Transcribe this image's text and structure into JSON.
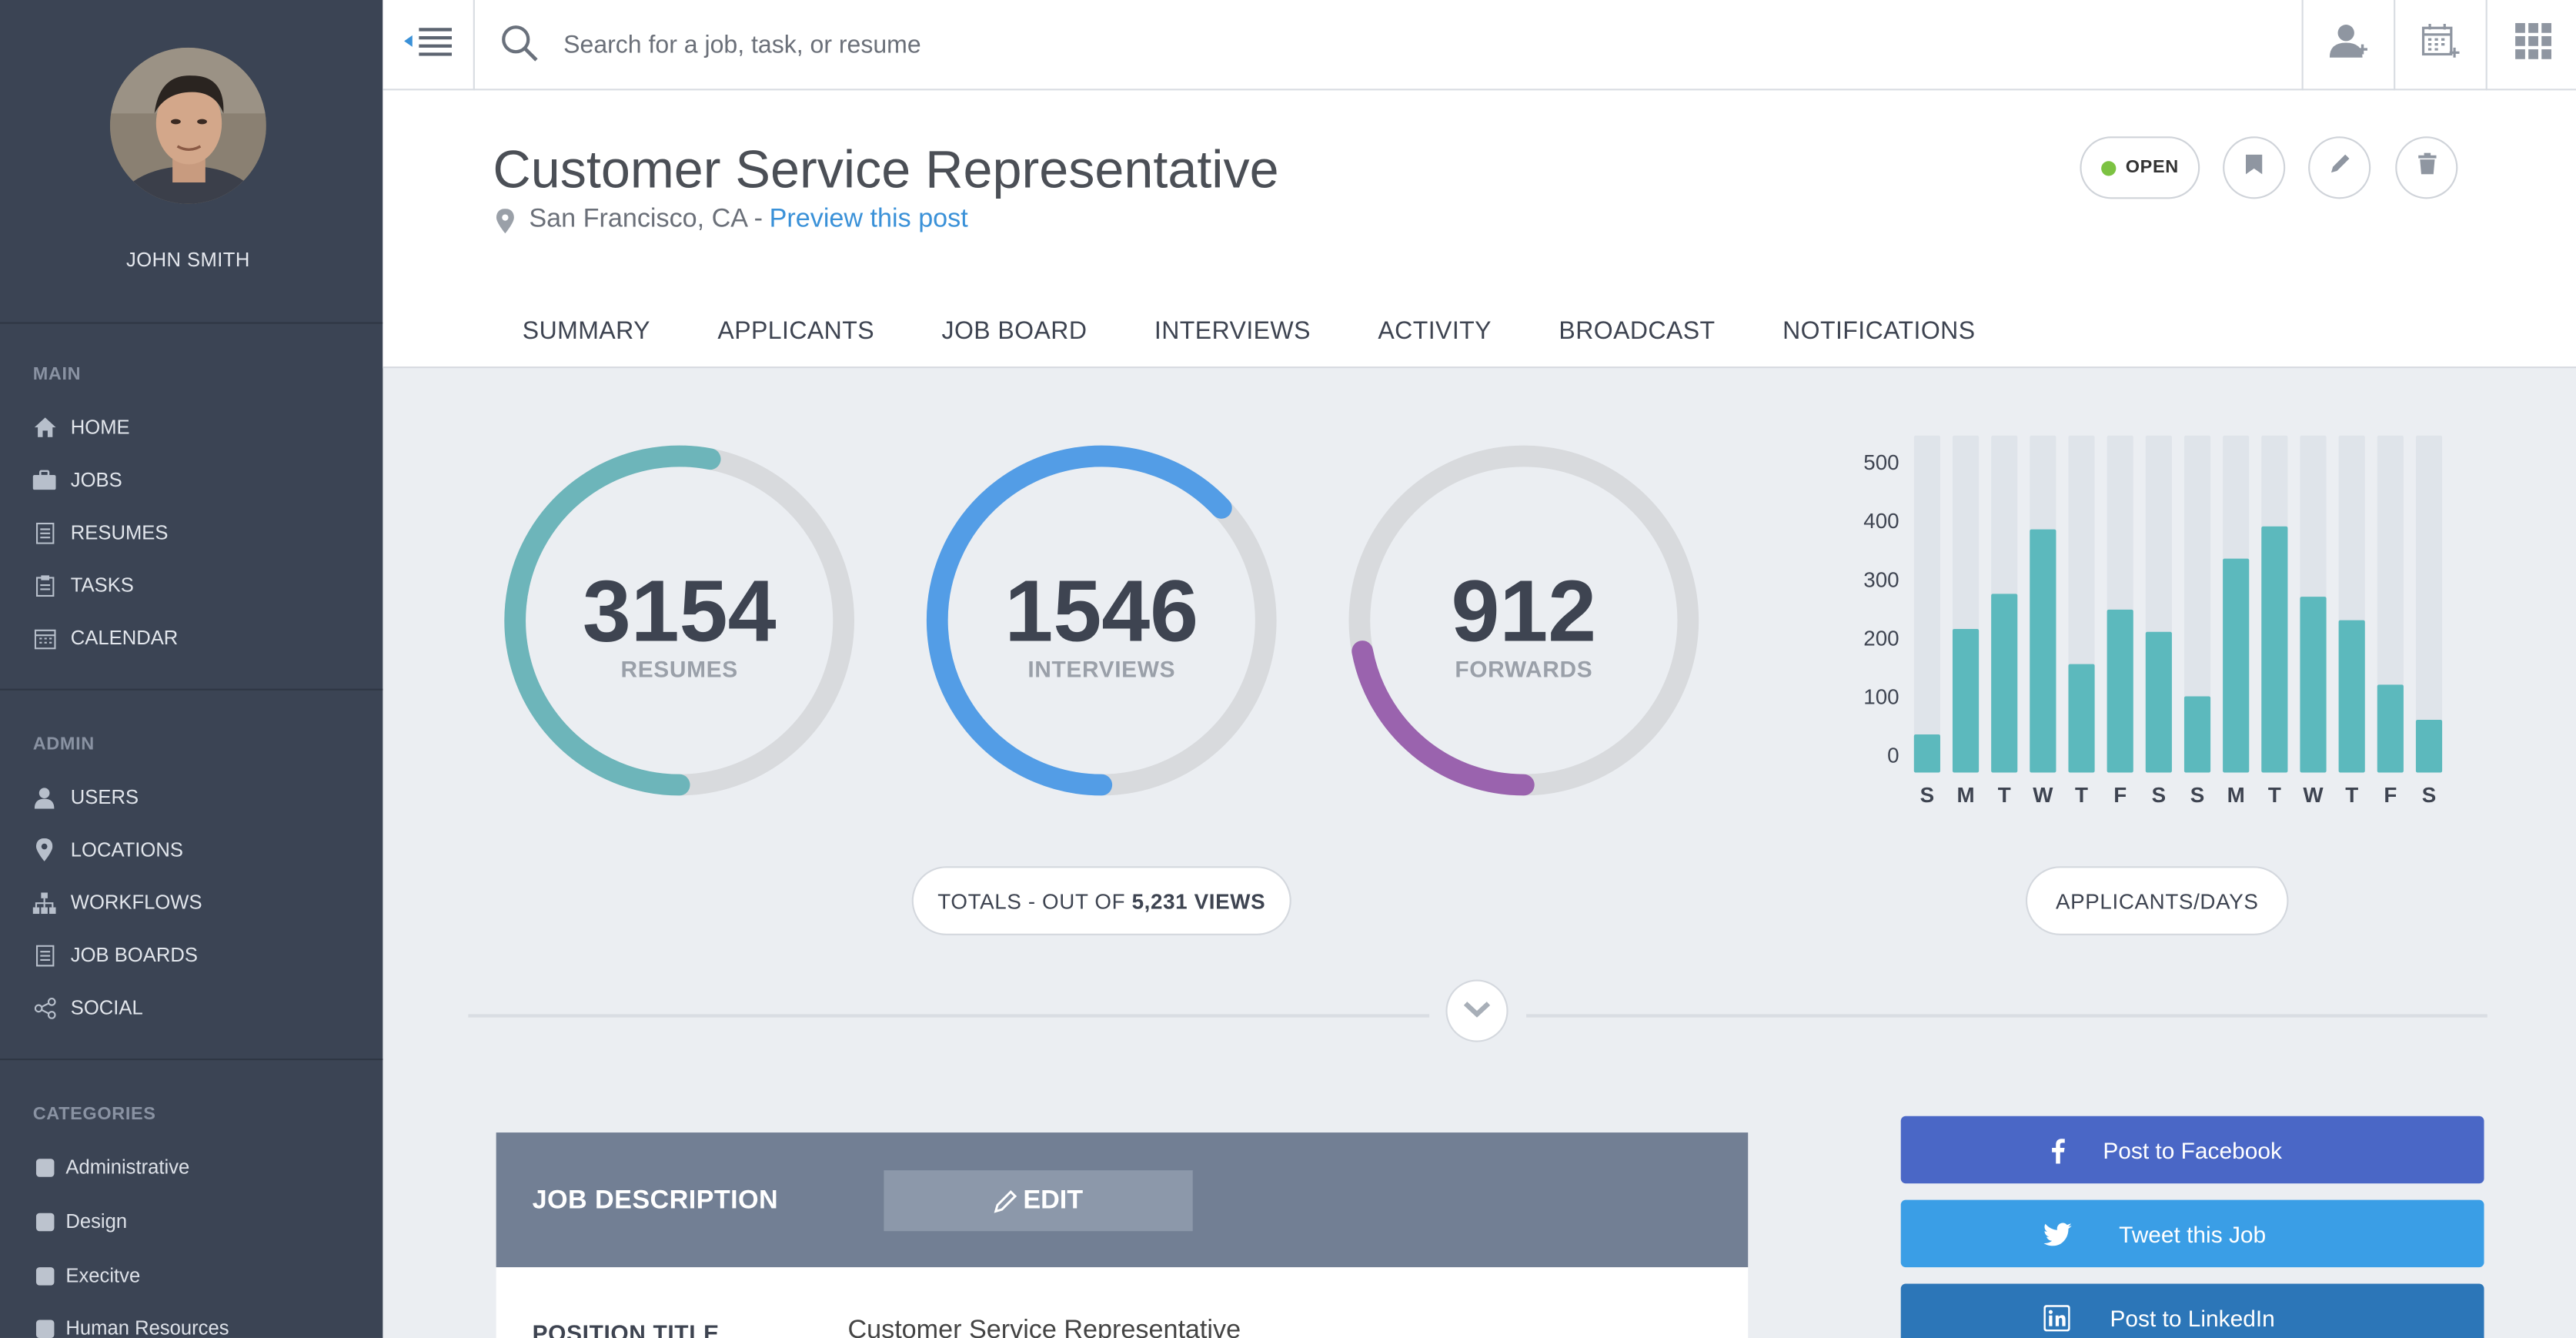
{
  "sidebar": {
    "user_name": "JOHN SMITH",
    "sections": {
      "main": "MAIN",
      "admin": "ADMIN",
      "categories": "CATEGORIES"
    },
    "main_items": [
      "HOME",
      "JOBS",
      "RESUMES",
      "TASKS",
      "CALENDAR"
    ],
    "admin_items": [
      "USERS",
      "LOCATIONS",
      "WORKFLOWS",
      "JOB BOARDS",
      "SOCIAL"
    ],
    "category_items": [
      "Administrative",
      "Design",
      "Execitve",
      "Human Resources"
    ]
  },
  "topbar": {
    "search_placeholder": "Search for a job, task, or resume"
  },
  "job": {
    "title": "Customer Service Representative",
    "location": "San Francisco, CA -",
    "preview_link": "Preview this post",
    "status": "OPEN"
  },
  "tabs": [
    "SUMMARY",
    "APPLICANTS",
    "JOB BOARD",
    "INTERVIEWS",
    "ACTIVITY",
    "BROADCAST",
    "NOTIFICATIONS"
  ],
  "stats": {
    "resumes": {
      "value": "3154",
      "label": "RESUMES",
      "fraction": 0.53,
      "color": "#6db5ba"
    },
    "interviews": {
      "value": "1546",
      "label": "INTERVIEWS",
      "fraction": 0.63,
      "color": "#539de6"
    },
    "forwards": {
      "value": "912",
      "label": "FORWARDS",
      "fraction": 0.22,
      "color": "#9a63ae"
    },
    "totals_prefix": "TOTALS - OUT OF",
    "totals_value": "5,231 VIEWS"
  },
  "chart_data": {
    "type": "bar",
    "categories": [
      "S",
      "M",
      "T",
      "W",
      "T",
      "F",
      "S",
      "S",
      "M",
      "T",
      "W",
      "T",
      "F",
      "S"
    ],
    "values": [
      65,
      245,
      305,
      415,
      185,
      278,
      240,
      130,
      365,
      420,
      300,
      260,
      150,
      90
    ],
    "max": 575,
    "yticks": [
      0,
      100,
      200,
      300,
      400,
      500
    ],
    "bar_color": "#5cb9bd",
    "track_color": "#dfe4ea",
    "button_label": "APPLICANTS/DAYS"
  },
  "job_description": {
    "header": "JOB DESCRIPTION",
    "edit_label": "EDIT",
    "position_title_label": "POSITION TITLE",
    "position_title_value": "Customer Service Representative"
  },
  "social": {
    "facebook": "Post to Facebook",
    "twitter": "Tweet this Job",
    "linkedin": "Post to LinkedIn",
    "colors": {
      "facebook": "#4a67c6",
      "twitter": "#3a9ee6",
      "linkedin": "#2c76b8"
    }
  }
}
